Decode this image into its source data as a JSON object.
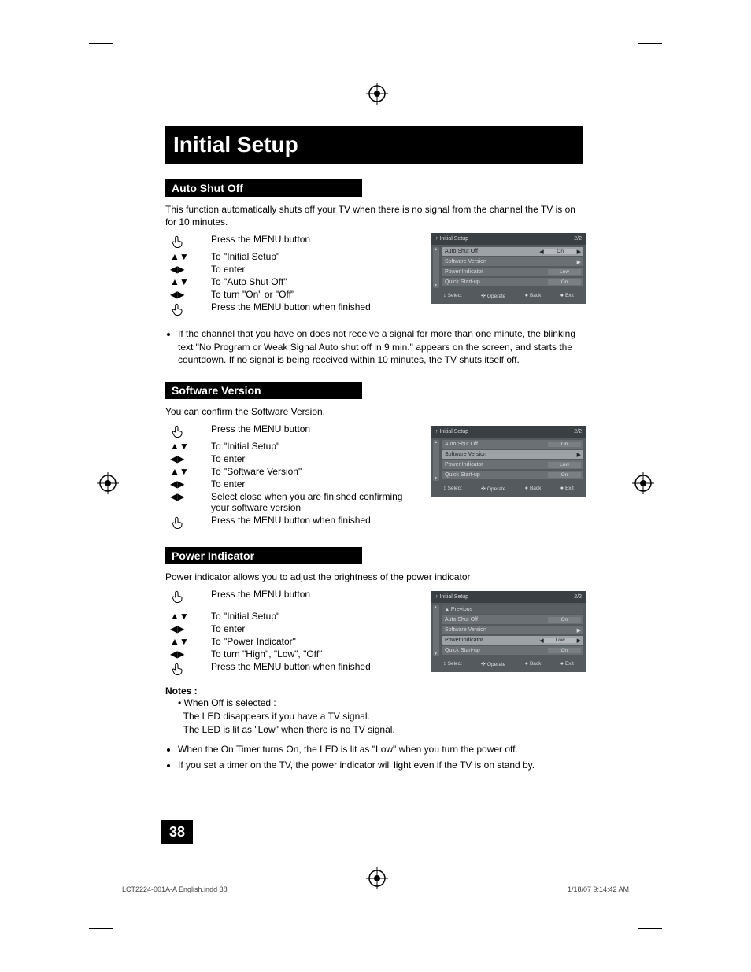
{
  "title": "Initial Setup",
  "page_num": "38",
  "footer_left": "LCT2224-001A-A English.indd   38",
  "footer_right": "1/18/07   9:14:42 AM",
  "sec1": {
    "heading": "Auto Shut Off",
    "intro": "This function automatically shuts off your TV when there is no signal from the channel the TV is on for 10 minutes.",
    "steps": {
      "s0": "Press the MENU button",
      "s1": "To \"Initial Setup\"",
      "s2": "To enter",
      "s3": "To \"Auto Shut Off\"",
      "s4": "To turn \"On\" or \"Off\"",
      "s5": "Press the MENU button when finished"
    },
    "bullet": "If the channel that you have on does not receive a signal for more than one minute, the blinking text \"No Program or Weak Signal Auto shut off in 9 min.\" appears on the screen, and starts the countdown. If no signal is being received within 10 minutes, the TV shuts itself off."
  },
  "sec2": {
    "heading": "Software Version",
    "intro": "You can confirm the Software Version.",
    "steps": {
      "s0": "Press the MENU button",
      "s1": "To \"Initial Setup\"",
      "s2": "To enter",
      "s3": "To \"Software Version\"",
      "s4": "To enter",
      "s5": "Select close when you are finished confirming your software version",
      "s6": "Press the MENU button when finished"
    }
  },
  "sec3": {
    "heading": "Power Indicator",
    "intro": "Power indicator allows you to adjust the brightness of the power indicator",
    "steps": {
      "s0": "Press the MENU button",
      "s1": "To \"Initial Setup\"",
      "s2": "To enter",
      "s3": "To \"Power Indicator\"",
      "s4": "To turn \"High\", \"Low\", \"Off\"",
      "s5": "Press the MENU button when finished"
    },
    "notes_head": "Notes :",
    "note1a": "When Off is selected :",
    "note1b": "The LED disappears if you have a TV signal.",
    "note1c": "The LED is lit as \"Low\" when there is no TV signal.",
    "note2": "When the On Timer turns On, the LED is lit as \"Low\" when you turn the power off.",
    "note3": "If you set a timer on the TV, the power indicator will light even if the TV is on stand by."
  },
  "osd": {
    "title": "Initial Setup",
    "page": "2/2",
    "prev": "Previous",
    "rows": {
      "auto": {
        "label": "Auto Shut Off",
        "val": "On"
      },
      "sw": {
        "label": "Software Version",
        "val": ""
      },
      "pi": {
        "label": "Power Indicator",
        "val": "Low"
      },
      "qs": {
        "label": "Quick Start-up",
        "val": "On"
      }
    },
    "foot": {
      "select": "Select",
      "operate": "Operate",
      "back": "Back",
      "exit": "Exit"
    }
  }
}
